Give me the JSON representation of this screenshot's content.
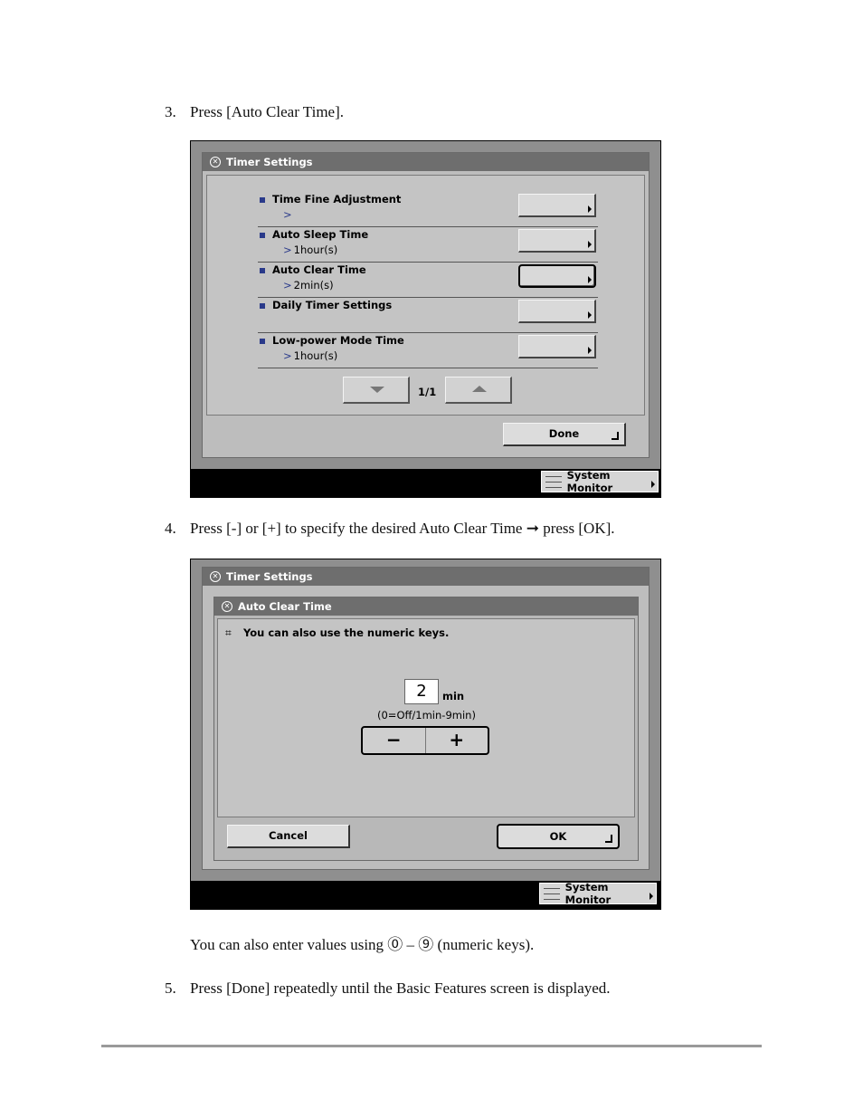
{
  "steps": [
    {
      "num": "3.",
      "text": "Press [Auto Clear Time]."
    },
    {
      "num": "4.",
      "text": "Press [-] or [+] to specify the desired Auto Clear Time ➞ press [OK]."
    },
    {
      "num": "5.",
      "text": "Press [Done] repeatedly until the Basic Features screen is displayed."
    }
  ],
  "note": "You can also enter values using ⓪ – ⑨ (numeric keys).",
  "screen1": {
    "title": "Timer Settings",
    "rows": [
      {
        "label": "Time Fine Adjustment",
        "value": ""
      },
      {
        "label": "Auto Sleep Time",
        "value": "1hour(s)"
      },
      {
        "label": "Auto Clear Time",
        "value": "2min(s)"
      },
      {
        "label": "Daily Timer Settings",
        "value": ""
      },
      {
        "label": "Low-power Mode Time",
        "value": "1hour(s)"
      }
    ],
    "page_indicator": "1/1",
    "done_label": "Done",
    "system_monitor_label": "System Monitor"
  },
  "screen2": {
    "title": "Timer Settings",
    "dialog_title": "Auto Clear Time",
    "hint": "You can also use the numeric keys.",
    "value": "2",
    "unit": "min",
    "range": "(0=Off/1min-9min)",
    "minus_label": "−",
    "plus_label": "+",
    "cancel_label": "Cancel",
    "ok_label": "OK",
    "system_monitor_label": "System Monitor"
  }
}
